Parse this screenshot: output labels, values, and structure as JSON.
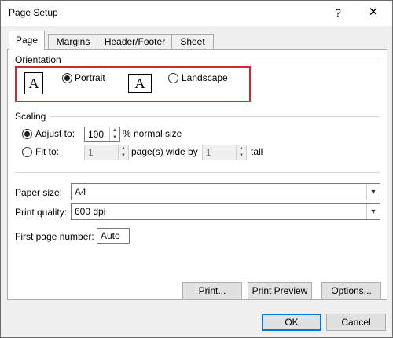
{
  "window": {
    "title": "Page Setup",
    "help": "?",
    "close": "✕"
  },
  "tabs": [
    {
      "label": "Page",
      "active": true
    },
    {
      "label": "Margins"
    },
    {
      "label": "Header/Footer"
    },
    {
      "label": "Sheet"
    }
  ],
  "orientation": {
    "heading": "Orientation",
    "portrait_icon": "A",
    "landscape_icon": "A",
    "portrait_label": "Portrait",
    "landscape_label": "Landscape",
    "selected": "Portrait"
  },
  "scaling": {
    "heading": "Scaling",
    "adjust_label": "Adjust to:",
    "adjust_value": "100",
    "adjust_suffix": "% normal size",
    "fit_label": "Fit to:",
    "fit_wide_value": "1",
    "fit_wide_suffix": "page(s) wide by",
    "fit_tall_value": "1",
    "fit_tall_suffix": "tall"
  },
  "paper": {
    "size_label": "Paper size:",
    "size_value": "A4",
    "quality_label": "Print quality:",
    "quality_value": "600 dpi",
    "first_page_label": "First page number:",
    "first_page_value": "Auto"
  },
  "buttons": {
    "print": "Print...",
    "print_preview": "Print Preview",
    "options": "Options...",
    "ok": "OK",
    "cancel": "Cancel"
  },
  "colors": {
    "highlight_border": "#d7262f",
    "focus_blue": "#0078d7"
  }
}
